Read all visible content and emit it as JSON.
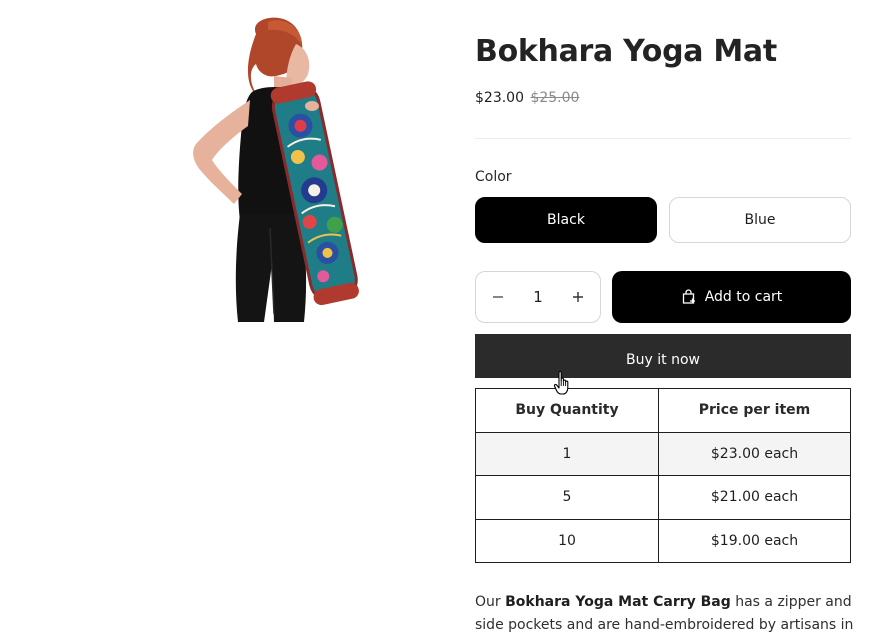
{
  "product": {
    "title": "Bokhara Yoga Mat",
    "sale_price": "$23.00",
    "compare_price": "$25.00"
  },
  "variants": {
    "label": "Color",
    "options": [
      "Black",
      "Blue"
    ],
    "selected": "Black"
  },
  "quantity": {
    "value": "1",
    "decrease_icon": "minus-icon",
    "increase_icon": "plus-icon"
  },
  "buttons": {
    "add_to_cart": "Add to cart",
    "add_to_cart_icon": "shopping-bag-icon",
    "buy_now": "Buy it now"
  },
  "tiers": {
    "headers": [
      "Buy Quantity",
      "Price per item"
    ],
    "rows": [
      [
        "1",
        "$23.00 each"
      ],
      [
        "5",
        "$21.00 each"
      ],
      [
        "10",
        "$19.00 each"
      ]
    ]
  },
  "description": {
    "intro": "Our ",
    "bold": "Bokhara Yoga Mat Carry Bag",
    "rest": " has a zipper and side pockets and are hand-embroidered by artisans in India."
  },
  "colors": {
    "primary_button": "#000000",
    "buy_now": "#2b2b2b",
    "shaded_row": "#f4f4f4"
  }
}
